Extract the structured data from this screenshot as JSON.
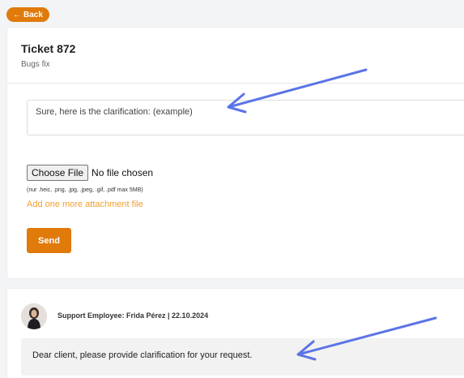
{
  "header": {
    "back_label": "Back",
    "back_icon": "arrow-left-icon"
  },
  "ticket": {
    "title": "Ticket 872",
    "subtitle": "Bugs fix"
  },
  "reply": {
    "text": "Sure, here is the clarification: (example)",
    "choose_file_label": "Choose File",
    "no_file_label": "No file chosen",
    "file_hint": "(nur .heic, .png, .jpg, .jpeg, .gif, .pdf max 5MB)",
    "add_attachment_label": "Add one more attachment file",
    "send_label": "Send"
  },
  "message": {
    "author": "Support Employee: Frida Pérez | 22.10.2024",
    "text": "Dear client, please provide clarification for your request."
  },
  "colors": {
    "accent": "#e07a0b",
    "link": "#f0a030",
    "arrow": "#5b74e6"
  }
}
